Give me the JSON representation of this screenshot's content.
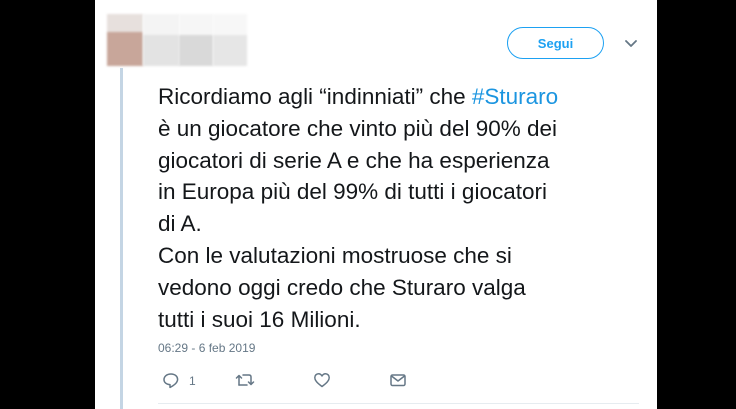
{
  "header": {
    "follow_label": "Segui",
    "menu_icon": "chevron-down-icon"
  },
  "tweet": {
    "lines": [
      {
        "before": "Ricordiamo agli “indinniati” che ",
        "hashtag": "#Sturaro"
      },
      {
        "text": "è un giocatore che vinto più del 90% dei"
      },
      {
        "text": "giocatori di serie A e che ha esperienza"
      },
      {
        "text": "in Europa più del 99% di tutti i giocatori"
      },
      {
        "text": "di A."
      },
      {
        "text": "Con le valutazioni  mostruose che si"
      },
      {
        "text": "vedono oggi credo che Sturaro valga"
      },
      {
        "text": "tutti i suoi 16 Milioni."
      }
    ],
    "timestamp": "06:29 - 6 feb 2019"
  },
  "actions": {
    "reply_icon": "reply-icon",
    "reply_count": "1",
    "retweet_icon": "retweet-icon",
    "like_icon": "heart-icon",
    "dm_icon": "envelope-icon"
  },
  "colors": {
    "accent": "#1da1f2",
    "hashtag": "#1b95e0",
    "text": "#14171a",
    "muted": "#657786",
    "thread_line": "#c4d5e4"
  }
}
